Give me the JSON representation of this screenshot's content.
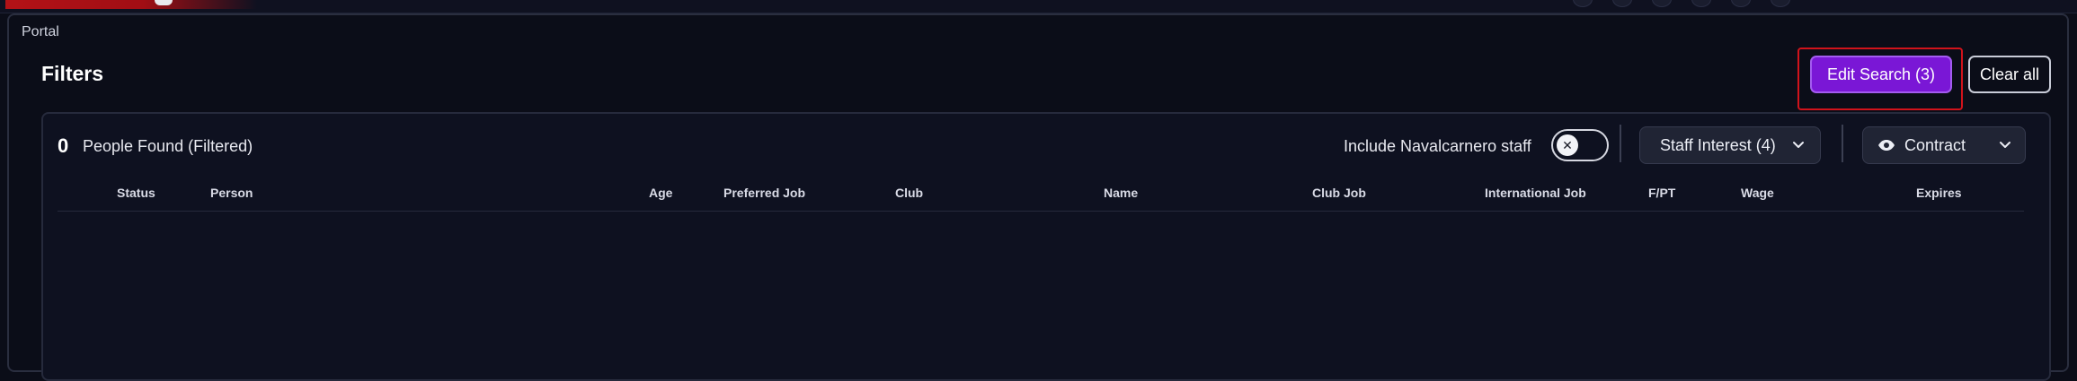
{
  "breadcrumb": {
    "portal": "Portal"
  },
  "header": {
    "title": "Filters"
  },
  "actions": {
    "edit_search": "Edit Search (3)",
    "clear_all": "Clear all"
  },
  "results": {
    "count": "0",
    "count_label": "People Found (Filtered)",
    "include_staff_label": "Include Navalcarnero staff",
    "include_staff_on": false,
    "staff_interest": "Staff Interest (4)",
    "contract": "Contract"
  },
  "table": {
    "columns": [
      "Status",
      "Person",
      "Age",
      "Preferred Job",
      "Club",
      "Name",
      "Club Job",
      "International Job",
      "F/PT",
      "Wage",
      "Expires"
    ],
    "rows": []
  },
  "icons": {
    "toggle_off": "close-icon",
    "contract": "eye-icon",
    "dropdown": "chevron-down-icon"
  },
  "colors": {
    "accent": "#7a17d6",
    "highlight": "#d1131b",
    "background": "#0b0d18"
  }
}
